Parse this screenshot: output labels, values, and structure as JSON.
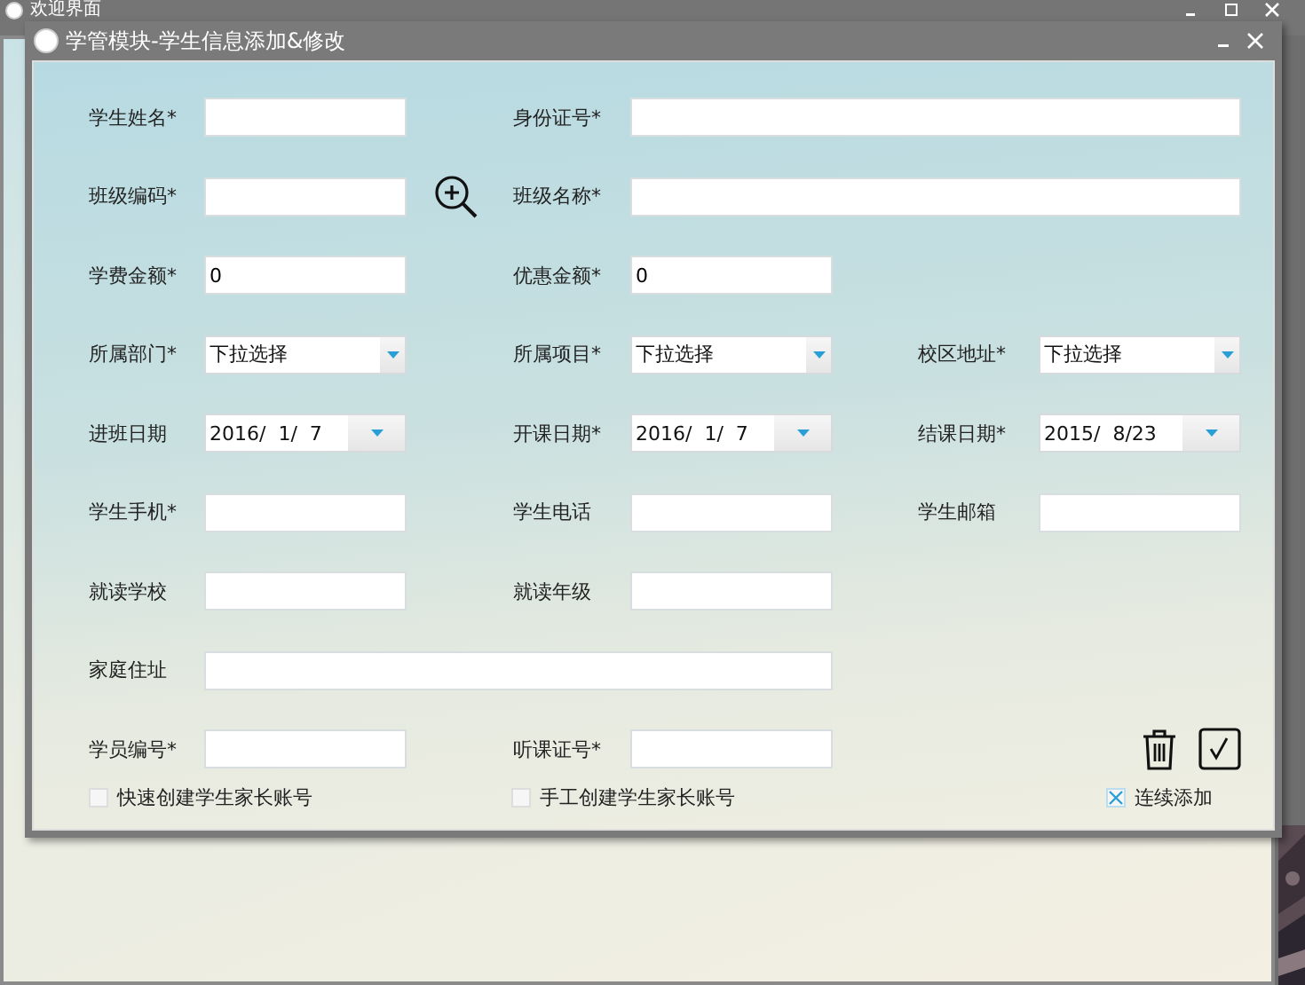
{
  "main_window": {
    "title": "欢迎界面"
  },
  "dialog": {
    "title": "学管模块-学生信息添加&修改"
  },
  "form": {
    "rows": [
      {
        "fields": [
          {
            "label": "学生姓名*",
            "kind": "text"
          },
          {
            "label": "身份证号*",
            "kind": "wide"
          }
        ]
      },
      {
        "fields": [
          {
            "label": "班级编码*",
            "kind": "text",
            "lookup": true
          },
          {
            "label": "班级名称*",
            "kind": "wide"
          }
        ]
      },
      {
        "fields": [
          {
            "label": "学费金额*",
            "kind": "text",
            "value": "0"
          },
          {
            "label": "优惠金额*",
            "kind": "text",
            "value": "0"
          }
        ]
      },
      {
        "fields": [
          {
            "label": "所属部门*",
            "kind": "dropdown",
            "value": "下拉选择"
          },
          {
            "label": "所属项目*",
            "kind": "dropdown",
            "value": "下拉选择"
          },
          {
            "label": "校区地址*",
            "kind": "dropdown",
            "value": "下拉选择"
          }
        ]
      },
      {
        "fields": [
          {
            "label": "进班日期",
            "kind": "date",
            "value": "2016/  1/  7"
          },
          {
            "label": "开课日期*",
            "kind": "date",
            "value": "2016/  1/  7"
          },
          {
            "label": "结课日期*",
            "kind": "date",
            "value": "2015/  8/23"
          }
        ]
      },
      {
        "fields": [
          {
            "label": "学生手机*",
            "kind": "text"
          },
          {
            "label": "学生电话",
            "kind": "text"
          },
          {
            "label": "学生邮箱",
            "kind": "text"
          }
        ]
      },
      {
        "fields": [
          {
            "label": "就读学校",
            "kind": "text"
          },
          {
            "label": "就读年级",
            "kind": "text"
          }
        ]
      },
      {
        "fields": [
          {
            "label": "家庭住址",
            "kind": "wide"
          }
        ]
      },
      {
        "fields": [
          {
            "label": "学员编号*",
            "kind": "text"
          },
          {
            "label": "听课证号*",
            "kind": "text"
          }
        ],
        "actions": true
      }
    ]
  },
  "checkboxes": [
    {
      "label": "快速创建学生家长账号",
      "checked": false
    },
    {
      "label": "手工创建学生家长账号",
      "checked": false
    },
    {
      "label": "连续添加",
      "checked": true
    }
  ]
}
